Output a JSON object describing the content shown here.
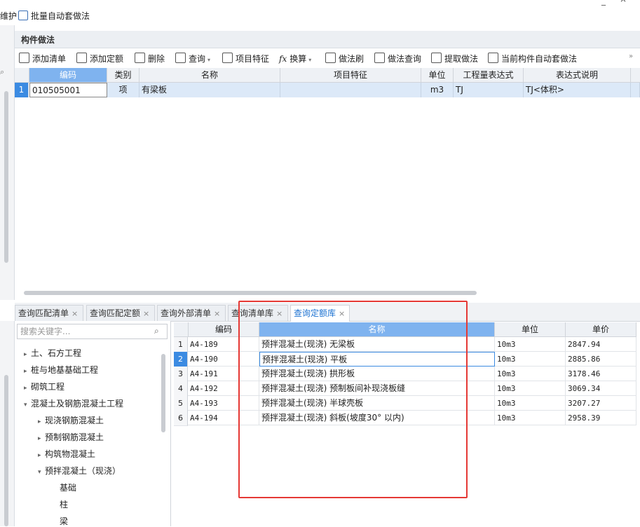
{
  "toolbar_top": {
    "partial_label": "维护",
    "batch_auto_label": "批量自动套做法"
  },
  "panel": {
    "title": "构件做法"
  },
  "toolbar2": {
    "add_list": "添加清单",
    "add_quota": "添加定额",
    "delete": "删除",
    "query": "查询",
    "item_feature": "项目特征",
    "convert": "换算",
    "method_brush": "做法刷",
    "method_query": "做法查询",
    "extract_method": "提取做法",
    "current_auto": "当前构件自动套做法"
  },
  "upper_table": {
    "headers": [
      "编码",
      "类别",
      "名称",
      "项目特征",
      "单位",
      "工程量表达式",
      "表达式说明"
    ],
    "rows": [
      {
        "num": "1",
        "code": "010505001",
        "type": "项",
        "name": "有梁板",
        "feature": "",
        "unit": "m3",
        "expr": "TJ",
        "expr_desc": "TJ<体积>"
      }
    ]
  },
  "lower_tabs": [
    {
      "label": "查询匹配清单",
      "active": false
    },
    {
      "label": "查询匹配定额",
      "active": false
    },
    {
      "label": "查询外部清单",
      "active": false
    },
    {
      "label": "查询清单库",
      "active": false
    },
    {
      "label": "查询定额库",
      "active": true
    }
  ],
  "search": {
    "placeholder": "搜索关键字..."
  },
  "tree": [
    {
      "label": "土、石方工程",
      "level": 0,
      "expanded": false
    },
    {
      "label": "桩与地基基础工程",
      "level": 0,
      "expanded": false
    },
    {
      "label": "砌筑工程",
      "level": 0,
      "expanded": false
    },
    {
      "label": "混凝土及钢筋混凝土工程",
      "level": 0,
      "expanded": true
    },
    {
      "label": "现浇钢筋混凝土",
      "level": 1,
      "expanded": false
    },
    {
      "label": "预制钢筋混凝土",
      "level": 1,
      "expanded": false
    },
    {
      "label": "构筑物混凝土",
      "level": 1,
      "expanded": false
    },
    {
      "label": "预拌混凝土（现浇）",
      "level": 1,
      "expanded": true
    },
    {
      "label": "基础",
      "level": 2,
      "expanded": false
    },
    {
      "label": "柱",
      "level": 2,
      "expanded": false
    },
    {
      "label": "梁",
      "level": 2,
      "expanded": false
    }
  ],
  "lower_table": {
    "headers": [
      "编码",
      "名称",
      "单位",
      "单价"
    ],
    "rows": [
      {
        "num": "1",
        "code": "A4-189",
        "name": "预拌混凝土(现浇) 无梁板",
        "unit": "10m3",
        "price": "2847.94"
      },
      {
        "num": "2",
        "code": "A4-190",
        "name": "预拌混凝土(现浇) 平板",
        "unit": "10m3",
        "price": "2885.86"
      },
      {
        "num": "3",
        "code": "A4-191",
        "name": "预拌混凝土(现浇) 拱形板",
        "unit": "10m3",
        "price": "3178.46"
      },
      {
        "num": "4",
        "code": "A4-192",
        "name": "预拌混凝土(现浇) 预制板间补现浇板缝",
        "unit": "10m3",
        "price": "3069.34"
      },
      {
        "num": "5",
        "code": "A4-193",
        "name": "预拌混凝土(现浇) 半球壳板",
        "unit": "10m3",
        "price": "3207.27"
      },
      {
        "num": "6",
        "code": "A4-194",
        "name": "预拌混凝土(现浇) 斜板(坡度30° 以内)",
        "unit": "10m3",
        "price": "2958.39"
      }
    ]
  },
  "colors": {
    "accent": "#1e73d2",
    "selected_header": "#7fb3ef",
    "highlight_box": "#e53935"
  }
}
